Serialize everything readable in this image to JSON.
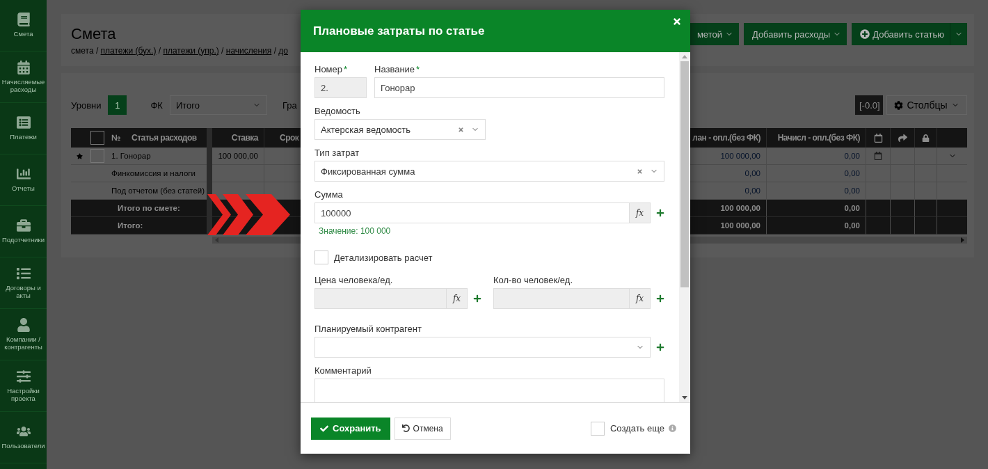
{
  "sidebar": {
    "items": [
      {
        "label": "Смета"
      },
      {
        "label": "Начисляемые расходы"
      },
      {
        "label": "Платежи"
      },
      {
        "label": "Отчеты"
      },
      {
        "label": "Подотчетники"
      },
      {
        "label": "Договоры и акты"
      },
      {
        "label": "Компании / контрагенты"
      },
      {
        "label": "Настройки проекта"
      },
      {
        "label": "Пользователи"
      }
    ]
  },
  "header": {
    "title": "Смета",
    "separator": "/",
    "breadcrumb": [
      {
        "label": "смета",
        "link": false
      },
      {
        "label": "платежи (бух.)",
        "link": true
      },
      {
        "label": "платежи (упр.)",
        "link": true
      },
      {
        "label": "начисления",
        "link": true
      },
      {
        "label": "до",
        "link": true
      }
    ],
    "actions": [
      {
        "kind": "dropdown",
        "label": "метой"
      },
      {
        "kind": "dropdown",
        "label": "Добавить расходы"
      },
      {
        "kind": "add",
        "label": "Добавить статью"
      },
      {
        "kind": "caret"
      }
    ]
  },
  "filters": {
    "levels_label": "Уровни",
    "levels": [
      {
        "label": "1",
        "selected": true
      }
    ],
    "fk_label": "ФК",
    "fk_value": "Итого",
    "group_label": "Гра",
    "precision": "[-0.0]",
    "columns_button": "Столбцы"
  },
  "table": {
    "header_checked": false,
    "columns": [
      {
        "label": "№"
      },
      {
        "label": "Статья расходов"
      },
      {
        "label": "Ставка"
      },
      {
        "label": "Срок"
      },
      {
        "label": "лан - опл.(без ФК)"
      },
      {
        "label": "Начисл - опл.(без ФК)"
      }
    ],
    "rows": [
      {
        "kind": "article",
        "starred": true,
        "checked": false,
        "name": "1. Гонорар",
        "rate": "100 000,00",
        "plan": "100 000,00",
        "accrued": "0,00",
        "dated": true,
        "expandable": true
      },
      {
        "kind": "service",
        "starred": false,
        "name": "Финкомиссия и налоги",
        "plan": "0,00",
        "accrued": "0,00",
        "dated": false,
        "expandable": false
      },
      {
        "kind": "service",
        "starred": false,
        "name": "Под отчетом (без статей)",
        "plan": "0,00",
        "accrued": "0,00",
        "dated": false,
        "expandable": false
      }
    ],
    "totals": [
      {
        "label": "Итого по смете:",
        "plan": "100 000,00",
        "accrued": "0,00"
      },
      {
        "label": "Итого:",
        "plan": "100 000,00",
        "accrued": "0,00"
      }
    ]
  },
  "modal": {
    "title": "Плановые затраты по статье",
    "required_mark": "*",
    "number": {
      "label": "Номер",
      "required": true,
      "value": "2.",
      "disabled": true
    },
    "name": {
      "label": "Название",
      "required": true,
      "value": "Гонорар",
      "disabled": false
    },
    "sheet": {
      "label": "Ведомость",
      "value": "Актерская ведомость",
      "clearable": true
    },
    "cost_type": {
      "label": "Тип затрат",
      "value": "Фиксированная сумма",
      "clearable": true
    },
    "amount": {
      "label": "Сумма",
      "value": "100000",
      "formula": "fx",
      "hint": "Значение: 100 000",
      "disabled": false
    },
    "detail": {
      "label": "Детализировать расчет",
      "checked": false
    },
    "unit_price": {
      "label": "Цена человека/ед.",
      "formula": "fx",
      "disabled": true
    },
    "quantity": {
      "label": "Кол-во человек/ед.",
      "formula": "fx",
      "disabled": true
    },
    "counterparty": {
      "label": "Планируемый контрагент"
    },
    "comment": {
      "label": "Комментарий"
    },
    "footer": {
      "save": "Сохранить",
      "cancel": "Отмена",
      "create_more": {
        "label": "Создать еще",
        "checked": false
      }
    }
  }
}
